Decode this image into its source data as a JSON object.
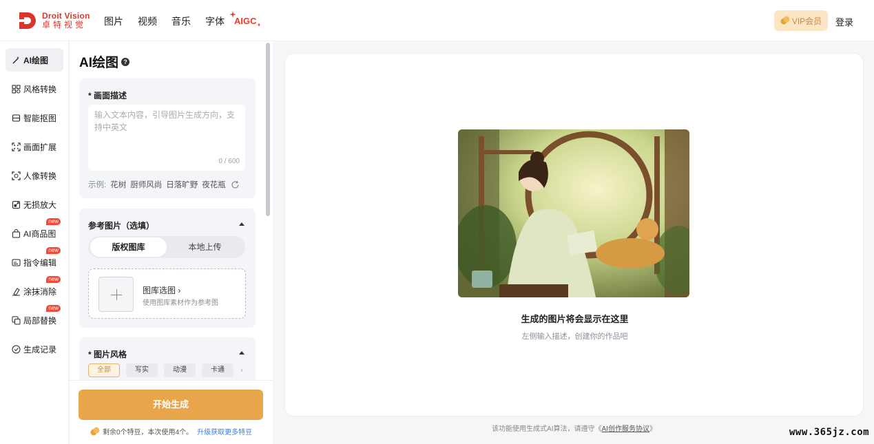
{
  "header": {
    "logo_en": "Droit Vision",
    "logo_cn": "卓特视觉",
    "nav": [
      "图片",
      "视频",
      "音乐",
      "字体"
    ],
    "aigc_label": "AIGC",
    "vip_label": "VIP会员",
    "login_label": "登录"
  },
  "sidebar": {
    "items": [
      {
        "label": "AI绘图",
        "icon": "magic-wand-icon",
        "active": true,
        "new": false
      },
      {
        "label": "风格转换",
        "icon": "grid-icon",
        "active": false,
        "new": false
      },
      {
        "label": "智能抠图",
        "icon": "cutout-icon",
        "active": false,
        "new": false
      },
      {
        "label": "画面扩展",
        "icon": "expand-icon",
        "active": false,
        "new": false
      },
      {
        "label": "人像转换",
        "icon": "face-scan-icon",
        "active": false,
        "new": false
      },
      {
        "label": "无损放大",
        "icon": "upscale-icon",
        "active": false,
        "new": false
      },
      {
        "label": "AI商品图",
        "icon": "shopping-bag-icon",
        "active": false,
        "new": true
      },
      {
        "label": "指令编辑",
        "icon": "image-edit-icon",
        "active": false,
        "new": true
      },
      {
        "label": "涂抹消除",
        "icon": "eraser-icon",
        "active": false,
        "new": true
      },
      {
        "label": "局部替换",
        "icon": "replace-icon",
        "active": false,
        "new": true
      },
      {
        "label": "生成记录",
        "icon": "check-circle-icon",
        "active": false,
        "new": false
      }
    ],
    "new_badge": "new"
  },
  "panel": {
    "title": "AI绘图",
    "help": "?",
    "prompt": {
      "label": "* 画面描述",
      "placeholder": "输入文本内容，引导图片生成方向，支持中英文",
      "counter": "0 / 600",
      "examples_label": "示例:",
      "examples": [
        "花树",
        "厨师风尚",
        "日落旷野",
        "夜花瓶"
      ]
    },
    "reference": {
      "label": "参考图片（选填）",
      "tabs": [
        "版权图库",
        "本地上传"
      ],
      "upload_title": "图库选图",
      "upload_chevron": "›",
      "upload_sub": "使用图库素材作为参考图"
    },
    "style": {
      "label": "* 图片风格",
      "chips": [
        "全部",
        "写实",
        "动漫",
        "卡通"
      ],
      "more": "›"
    },
    "generate_label": "开始生成",
    "quota_text": "剩余0个特豆，本次使用4个。",
    "quota_link": "升级获取更多特豆"
  },
  "preview": {
    "title": "生成的图片将会显示在这里",
    "subtitle": "左侧输入描述，创建你的作品吧"
  },
  "footer": {
    "note_prefix": "该功能使用生成式AI算法，请遵守《",
    "note_link": "AI创作服务协议",
    "note_suffix": "》"
  },
  "watermark": "www.365jz.com",
  "colors": {
    "brand_red": "#d9362b",
    "accent_orange": "#e8a54a",
    "vip_bg": "#fbe7c6",
    "link_blue": "#3b7ee8"
  }
}
